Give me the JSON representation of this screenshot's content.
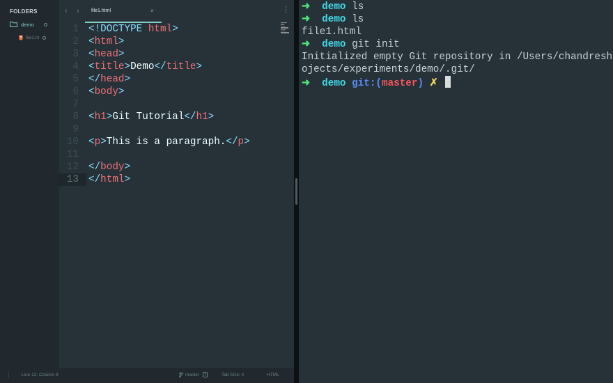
{
  "sidebar": {
    "header": "FOLDERS",
    "folder": {
      "name": "demo",
      "icon": "folder-icon"
    },
    "file": {
      "name": "file1.ht",
      "icon": "html-file-icon"
    }
  },
  "tabbar": {
    "back_icon": "chevron-left-icon",
    "forward_icon": "chevron-right-icon",
    "active_tab": "file1.html",
    "close_glyph": "×",
    "menu_glyph": "⋮"
  },
  "code": {
    "lines": [
      {
        "n": "1",
        "text": "<!DOCTYPE html>"
      },
      {
        "n": "2",
        "text": "<html>"
      },
      {
        "n": "3",
        "text": "<head>"
      },
      {
        "n": "4",
        "text": "<title>Demo</title>"
      },
      {
        "n": "5",
        "text": "</head>"
      },
      {
        "n": "6",
        "text": "<body>"
      },
      {
        "n": "7",
        "text": ""
      },
      {
        "n": "8",
        "text": "<h1>Git Tutorial</h1>"
      },
      {
        "n": "9",
        "text": ""
      },
      {
        "n": "10",
        "text": "<p>This is a paragraph.</p>"
      },
      {
        "n": "11",
        "text": ""
      },
      {
        "n": "12",
        "text": "</body>"
      },
      {
        "n": "13",
        "text": "</html>"
      }
    ],
    "active_line": "13"
  },
  "statusbar": {
    "position": "Line 13, Column 8",
    "branch": "master",
    "branch_badge": "1",
    "tab_size": "Tab Size: 4",
    "syntax": "HTML"
  },
  "terminal": {
    "prompt_arrow": "➜",
    "lines": [
      {
        "kind": "prompt",
        "dir": "demo",
        "cmd": "ls"
      },
      {
        "kind": "prompt",
        "dir": "demo",
        "cmd": "ls"
      },
      {
        "kind": "output",
        "text": "file1.html"
      },
      {
        "kind": "prompt",
        "dir": "demo",
        "cmd": "git init"
      },
      {
        "kind": "output",
        "text": "Initialized empty Git repository in /Users/chandresh/pr"
      },
      {
        "kind": "output",
        "text": "ojects/experiments/demo/.git/"
      }
    ],
    "current_prompt": {
      "dir": "demo",
      "git_label": "git:(",
      "branch": "master",
      "git_close": ")",
      "dirty_mark": "✗"
    }
  },
  "colors": {
    "background": "#263238",
    "tag": "#f07178",
    "punctuation": "#89ddff",
    "accent": "#80cbc4",
    "prompt_arrow": "#50e279",
    "prompt_dir": "#43d7e6",
    "git_label": "#5a8cf5",
    "branch": "#f0545c",
    "dirty_mark": "#f3d35a"
  }
}
